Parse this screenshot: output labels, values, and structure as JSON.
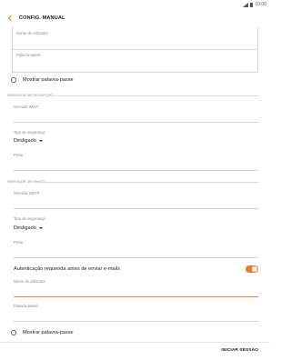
{
  "status_bar": {
    "time": "10:00"
  },
  "header": {
    "title": "CONFIG. MANUAL"
  },
  "incoming_top": {
    "username_label": "Nome de utilizador",
    "password_label": "Palavra-passe",
    "show_password_label": "Mostrar palavra-passe"
  },
  "incoming_server": {
    "section_title": "SERVIDOR DE RECEPÇÃO",
    "server_label": "Servidor IMAP",
    "security_label": "Tipo de segurança",
    "security_value": "Desligado",
    "port_label": "Porta"
  },
  "outgoing_server": {
    "section_title": "SERVIDOR DE ENVIO",
    "server_label": "Servidor SMTP",
    "security_label": "Tipo de segurança",
    "security_value": "Desligado",
    "port_label": "Porta",
    "auth_label": "Autenticação requerida antes de enviar e-mails",
    "auth_enabled": true,
    "username_label": "Nome de utilizador",
    "password_label": "Palavra-passe",
    "show_password_label": "Mostrar palavra-passe"
  },
  "footer": {
    "login_button": "INICIAR SESSÃO"
  },
  "colors": {
    "accent": "#f27b32"
  }
}
